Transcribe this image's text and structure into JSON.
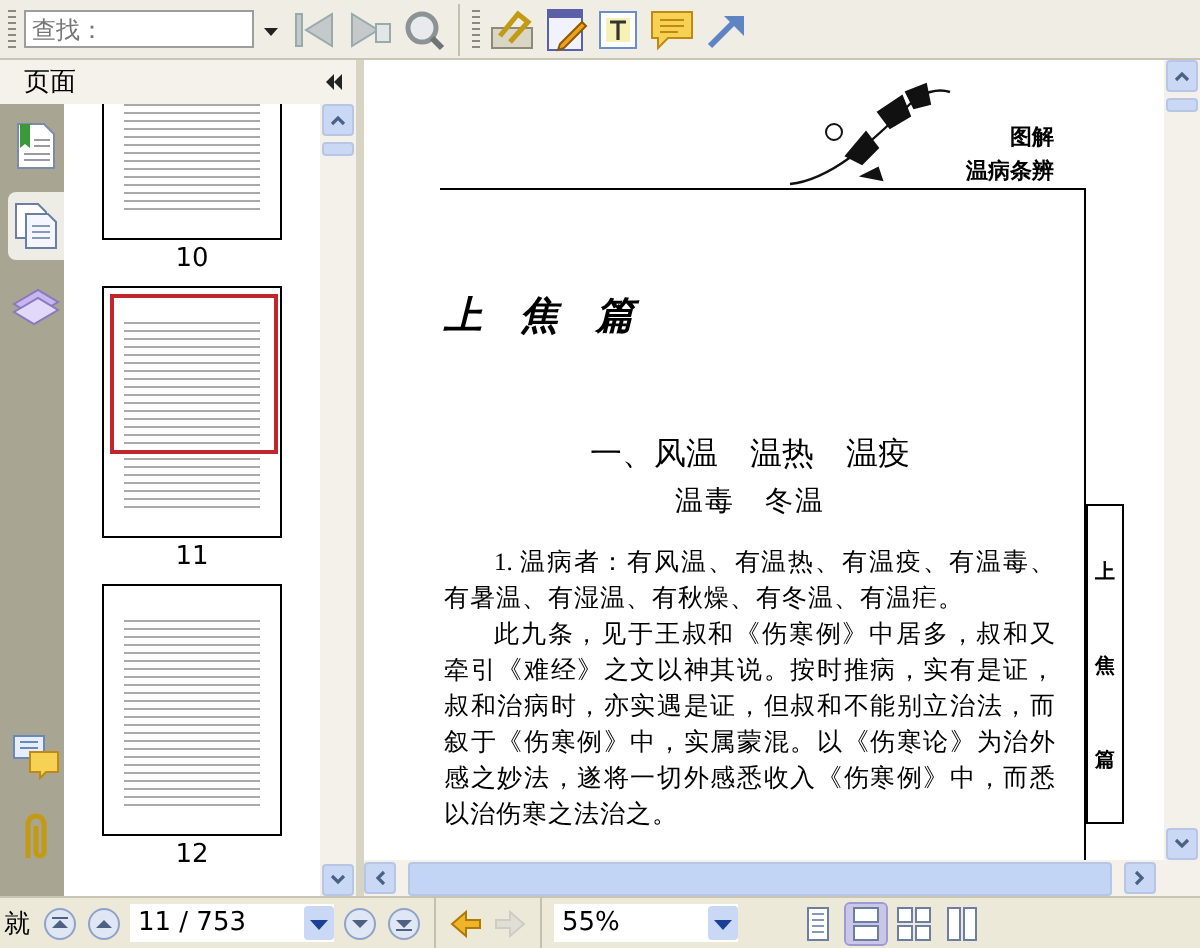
{
  "toolbar": {
    "search": {
      "placeholder": "查找："
    }
  },
  "sidebar": {
    "title": "页面",
    "tabs": [
      {
        "kind": "bookmarks",
        "selected": false
      },
      {
        "kind": "pages",
        "selected": true
      },
      {
        "kind": "layers",
        "selected": false
      }
    ],
    "bottom_tabs": [
      {
        "kind": "comments"
      },
      {
        "kind": "attachments"
      }
    ],
    "thumbnails": [
      {
        "label": "10",
        "selected": false
      },
      {
        "label": "11",
        "selected": true
      },
      {
        "label": "12",
        "selected": false
      }
    ]
  },
  "document": {
    "header": [
      "图解",
      "温病条辨"
    ],
    "part_title": "上　焦　篇",
    "section_title": "一、风温　温热　温疫",
    "section_subtitle": "温毒　冬温",
    "paragraphs": [
      "1. 温病者：有风温、有温热、有温疫、有温毒、有暑温、有湿温、有秋燥、有冬温、有温疟。",
      "此九条，见于王叔和《伤寒例》中居多，叔和又牵引《难经》之文以神其说。按时推病，实有是证，叔和治病时，亦实遇是证，但叔和不能别立治法，而叙于《伤寒例》中，实属蒙混。以《伤寒论》为治外感之妙法，遂将一切外感悉收入《伤寒例》中，而悉以治伤寒之法治之。"
    ],
    "side_tab": "上焦篇"
  },
  "status_bar": {
    "status_text": "就",
    "page_field": "11 / 753",
    "zoom_field": "55%",
    "history": [
      {
        "kind": "back",
        "disabled": false
      },
      {
        "kind": "forward",
        "disabled": true
      }
    ],
    "views": [
      {
        "kind": "single",
        "selected": false
      },
      {
        "kind": "continuous",
        "selected": true
      },
      {
        "kind": "facing",
        "selected": false
      },
      {
        "kind": "continuous-facing",
        "selected": false
      }
    ]
  }
}
